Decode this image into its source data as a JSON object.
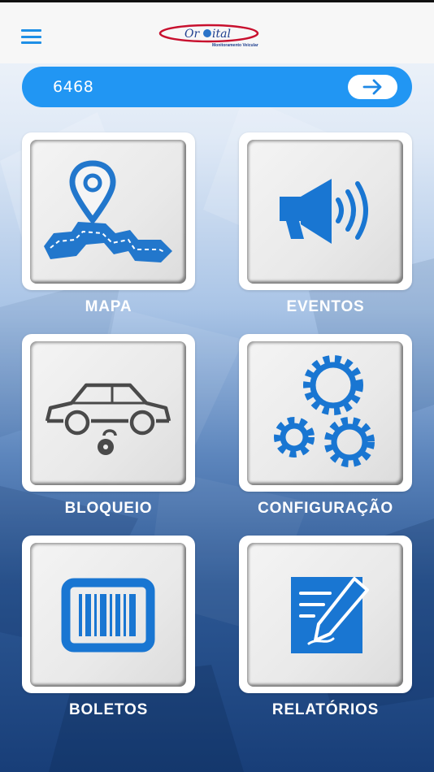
{
  "header": {
    "logo_text": "Orbital",
    "logo_subtext": "Monitoramento Veicular"
  },
  "search": {
    "value": "6468"
  },
  "tiles": [
    {
      "id": "mapa",
      "label": "MAPA",
      "icon": "map-route-icon"
    },
    {
      "id": "eventos",
      "label": "EVENTOS",
      "icon": "megaphone-icon"
    },
    {
      "id": "bloqueio",
      "label": "BLOQUEIO",
      "icon": "car-lock-icon"
    },
    {
      "id": "configuracao",
      "label": "CONFIGURAÇÃO",
      "icon": "gears-icon"
    },
    {
      "id": "boletos",
      "label": "BOLETOS",
      "icon": "barcode-icon"
    },
    {
      "id": "relatorios",
      "label": "RELATÓRIOS",
      "icon": "report-pen-icon"
    }
  ],
  "colors": {
    "accent": "#2196f3",
    "icon_blue": "#1976d2",
    "logo_red": "#c8102e",
    "label": "#ffffff"
  }
}
